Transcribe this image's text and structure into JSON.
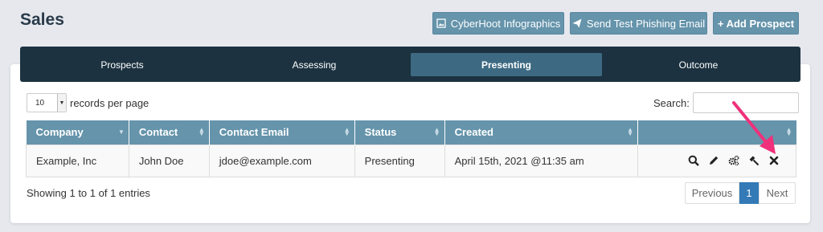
{
  "page": {
    "title": "Sales"
  },
  "header_buttons": {
    "infographics": "CyberHoot Infographics",
    "phishing": "Send Test Phishing Email",
    "add_prospect": "+ Add Prospect"
  },
  "tabs": [
    "Prospects",
    "Assessing",
    "Presenting",
    "Outcome"
  ],
  "active_tab": "Presenting",
  "table_controls": {
    "length_value": "10",
    "length_label": "records per page",
    "search_label": "Search:"
  },
  "table": {
    "columns": [
      "Company",
      "Contact",
      "Contact Email",
      "Status",
      "Created"
    ],
    "rows": [
      {
        "company": "Example, Inc",
        "contact": "John Doe",
        "email": "jdoe@example.com",
        "status": "Presenting",
        "created": "April 15th, 2021 @11:35 am"
      }
    ],
    "row_actions": [
      "search-icon",
      "edit-icon",
      "gears-icon",
      "gavel-icon",
      "close-icon"
    ]
  },
  "footer": {
    "info": "Showing 1 to 1 of 1 entries",
    "prev": "Previous",
    "current": "1",
    "next": "Next"
  },
  "colors": {
    "accent": "#6594ab",
    "tabbar": "#1c3240",
    "active_tab": "#3d6a82",
    "annotation_arrow": "#f0307a",
    "pager_active": "#337ab7"
  }
}
